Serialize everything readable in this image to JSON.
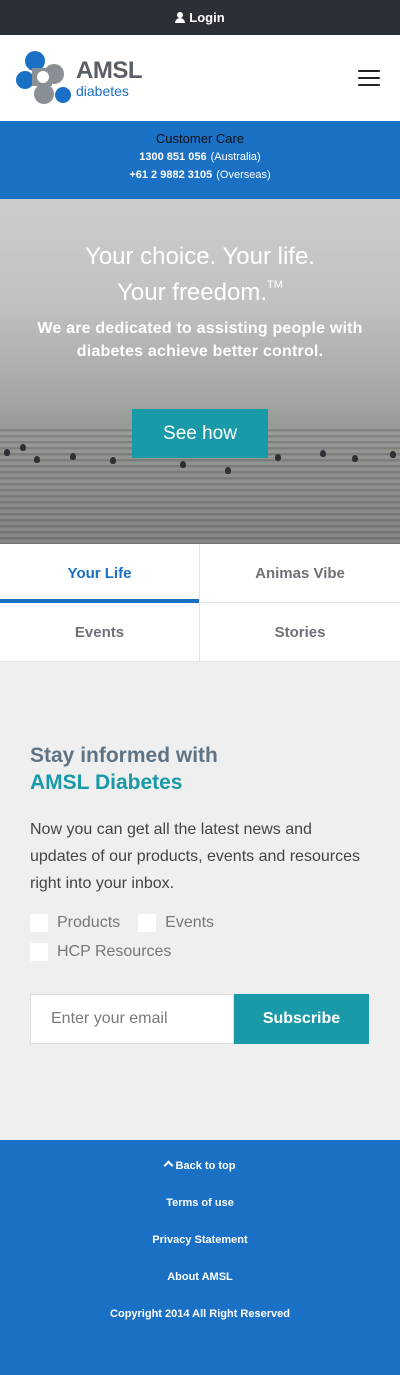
{
  "topbar": {
    "login_label": "Login",
    "icon": "user-icon"
  },
  "header": {
    "brand": "AMSL",
    "brand_sub": "diabetes",
    "menu_icon": "hamburger-icon"
  },
  "customer_care": {
    "title": "Customer Care",
    "lines": [
      {
        "number": "1300 851 056",
        "region": "(Australia)"
      },
      {
        "number": "+61 2 9882 3105",
        "region": "(Overseas)"
      }
    ]
  },
  "hero": {
    "title_line1": "Your choice. Your life.",
    "title_line2": "Your freedom.",
    "trademark": "TM",
    "subtitle": "We are dedicated to assisting people with diabetes achieve better control.",
    "cta_label": "See how"
  },
  "tabs": [
    {
      "label": "Your Life",
      "active": true
    },
    {
      "label": "Animas Vibe",
      "active": false
    },
    {
      "label": "Events",
      "active": false
    },
    {
      "label": "Stories",
      "active": false
    }
  ],
  "newsletter": {
    "heading_line1": "Stay informed with",
    "heading_brand": "AMSL Diabetes",
    "text": "Now you can get all the latest news and updates of our products, events and resources right into your inbox.",
    "options": [
      "Products",
      "Events",
      "HCP Resources"
    ],
    "email_placeholder": "Enter your email",
    "subscribe_label": "Subscribe"
  },
  "footer": {
    "back_to_top": "Back to top",
    "terms": "Terms of use",
    "privacy": "Privacy Statement",
    "about": "About AMSL",
    "copyright": "Copyright 2014 All Right Reserved"
  },
  "colors": {
    "primary_blue": "#1a70c5",
    "teal": "#1a9aa8",
    "dark_bar": "#2b2f36",
    "logo_gray": "#5a5f66"
  }
}
